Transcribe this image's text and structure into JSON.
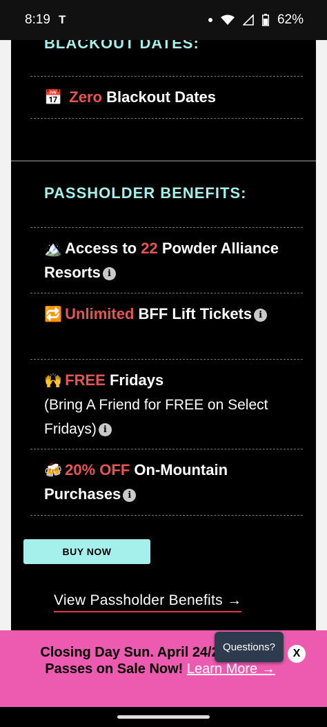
{
  "status_bar": {
    "time": "8:19",
    "left_icon": "tesla-icon",
    "battery": "62%"
  },
  "sections": {
    "blackout": {
      "heading": "BLACKOUT DATES:",
      "item": {
        "icon": "calendar-icon",
        "highlight": "Zero",
        "text": " Blackout Dates"
      }
    },
    "benefits": {
      "heading": "PASSHOLDER BENEFITS:",
      "items": [
        {
          "icon": "mountain-icon",
          "prefix": "Access to ",
          "highlight": "22",
          "text": " Powder Alliance Resorts"
        },
        {
          "icon": "repeat-icon",
          "highlight": "Unlimited",
          "text": " BFF Lift Tickets"
        },
        {
          "icon": "raised-hands-icon",
          "highlight": "FREE",
          "text": " Fridays",
          "subtext": "(Bring A Friend for FREE on Select Fridays)"
        },
        {
          "icon": "beers-icon",
          "highlight": "20% OFF",
          "text": " On-Mountain Purchases"
        }
      ]
    }
  },
  "buy_button": "BUY NOW",
  "view_link": "View Passholder Benefits →",
  "banner": {
    "text": "Closing Day Sun. April 24/25 Season Passes on Sale Now!",
    "link": "Learn More →"
  },
  "chat_button": "Questions?",
  "close_button": "X",
  "colors": {
    "accent_teal": "#a5f0ea",
    "highlight_red": "#e65555",
    "banner_pink": "#ed5bb0"
  }
}
